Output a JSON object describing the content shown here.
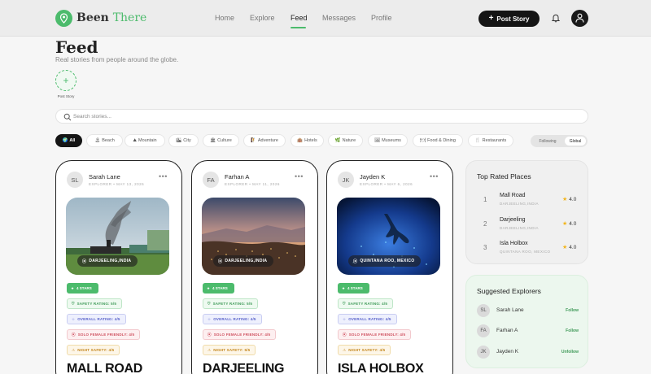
{
  "brand": {
    "name_part1": "Been ",
    "name_part2": "There",
    "accent": "#4cbb6c"
  },
  "nav": {
    "items": [
      "Home",
      "Explore",
      "Feed",
      "Messages",
      "Profile"
    ],
    "active": "Feed"
  },
  "header": {
    "post_story": "Post Story"
  },
  "page": {
    "title": "Feed",
    "subtitle": "Real stories from people around the globe."
  },
  "story": {
    "add_label": "Post Story"
  },
  "search": {
    "placeholder": "Search stories..."
  },
  "filters": {
    "chips": [
      {
        "icon": "🌍",
        "label": "All"
      },
      {
        "icon": "🏝",
        "label": "Beach"
      },
      {
        "icon": "⛰",
        "label": "Mountain"
      },
      {
        "icon": "🏙",
        "label": "City"
      },
      {
        "icon": "🏛",
        "label": "Culture"
      },
      {
        "icon": "🧗",
        "label": "Adventure"
      },
      {
        "icon": "🏨",
        "label": "Hotels"
      },
      {
        "icon": "🌿",
        "label": "Nature"
      },
      {
        "icon": "🖼",
        "label": "Museums"
      },
      {
        "icon": "🍽",
        "label": "Food & Dining"
      },
      {
        "icon": "🍴",
        "label": "Restaurants"
      }
    ],
    "active": "All",
    "scope_following": "Following",
    "scope_global": "Global"
  },
  "feed": {
    "cards": [
      {
        "initials": "SL",
        "author": "Sarah Lane",
        "meta": "EXPLORER • MAY 13, 2026",
        "location": "DARJEELING,INDIA",
        "stars": "4 STARS",
        "safety": "SAFETY RATING: 5/5",
        "overall": "OVERALL RATING: 4/5",
        "solo": "SOLO FEMALE FRIENDLY: 4/5",
        "night": "NIGHT SAFETY: 4/5",
        "title": "MALL ROAD"
      },
      {
        "initials": "FA",
        "author": "Farhan A",
        "meta": "EXPLORER • MAY 11, 2026",
        "location": "DARJEELING,INDIA",
        "stars": "4 STARS",
        "safety": "SAFETY RATING: 5/5",
        "overall": "OVERALL RATING: 4/5",
        "solo": "SOLO FEMALE FRIENDLY: 4/5",
        "night": "NIGHT SAFETY: 5/5",
        "title": "DARJEELING"
      },
      {
        "initials": "JK",
        "author": "Jayden K",
        "meta": "EXPLORER • MAY 6, 2026",
        "location": "QUINTANA ROO, MEXICO",
        "stars": "4 STARS",
        "safety": "SAFETY RATING: 4/5",
        "overall": "OVERALL RATING: 4/5",
        "solo": "SOLO FEMALE FRIENDLY: 4/5",
        "night": "NIGHT SAFETY: 4/5",
        "title": "ISLA HOLBOX"
      }
    ]
  },
  "top_rated": {
    "title": "Top Rated Places",
    "places": [
      {
        "rank": "1",
        "name": "Mall Road",
        "location": "DARJEELING,INDIA",
        "rating": "4.0"
      },
      {
        "rank": "2",
        "name": "Darjeeling",
        "location": "DARJEELING,INDIA",
        "rating": "4.0"
      },
      {
        "rank": "3",
        "name": "Isla Holbox",
        "location": "QUINTANA ROO, MEXICO",
        "rating": "4.0"
      }
    ]
  },
  "suggested": {
    "title": "Suggested Explorers",
    "explorers": [
      {
        "initials": "SL",
        "name": "Sarah Lane",
        "action": "Follow"
      },
      {
        "initials": "FA",
        "name": "Farhan A",
        "action": "Follow"
      },
      {
        "initials": "JK",
        "name": "Jayden K",
        "action": "Unfollow"
      }
    ]
  }
}
